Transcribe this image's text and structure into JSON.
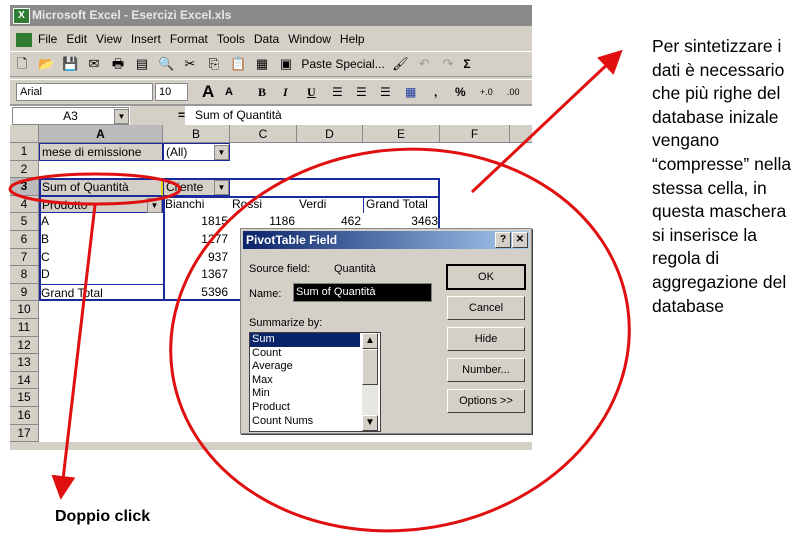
{
  "window": {
    "title": "Microsoft Excel - Esercizi Excel.xls"
  },
  "menu": [
    "File",
    "Edit",
    "View",
    "Insert",
    "Format",
    "Tools",
    "Data",
    "Window",
    "Help"
  ],
  "toolbar": {
    "paste_special": "Paste Special...",
    "sum_icon": "Σ"
  },
  "format_toolbar": {
    "font": "Arial",
    "size": "10",
    "bold": "B",
    "italic": "I",
    "underline": "U",
    "comma": ",",
    "percent": "%"
  },
  "formula_bar": {
    "name_box": "A3",
    "equals": "=",
    "content": "Sum of Quantità"
  },
  "columns": [
    "A",
    "B",
    "C",
    "D",
    "E",
    "F"
  ],
  "rows": [
    "1",
    "2",
    "3",
    "4",
    "5",
    "6",
    "7",
    "8",
    "9",
    "10",
    "11",
    "12",
    "13",
    "14",
    "15",
    "16",
    "17"
  ],
  "pivot": {
    "page_field": "mese di emissione",
    "page_value": "(All)",
    "data_field": "Sum of Quantità",
    "column_field": "Cliente",
    "row_field": "Prodotto",
    "column_items": [
      "Bianchi",
      "Rossi",
      "Verdi",
      "Grand Total"
    ],
    "row_items": [
      "A",
      "B",
      "C",
      "D",
      "Grand Total"
    ],
    "values": [
      [
        "1815",
        "1186",
        "462",
        "3463"
      ],
      [
        "1277"
      ],
      [
        "937"
      ],
      [
        "1367"
      ],
      [
        "5396"
      ]
    ]
  },
  "dialog": {
    "title": "PivotTable Field",
    "help": "?",
    "close": "✕",
    "source_label": "Source field:",
    "source_value": "Quantità",
    "name_label": "Name:",
    "name_value": "Sum of Quantità",
    "summarize_label": "Summarize by:",
    "functions": [
      "Sum",
      "Count",
      "Average",
      "Max",
      "Min",
      "Product",
      "Count Nums"
    ],
    "selected": "Sum",
    "buttons": [
      "OK",
      "Cancel",
      "Hide",
      "Number...",
      "Options >>"
    ]
  },
  "annotations": {
    "side_text": "Per sintetizzare i dati è necessario che più righe del database inizale vengano “compresse” nella stessa cella, in questa maschera si inserisce la regola di aggregazione del database",
    "click_label": "Doppio click",
    "color": "#e01010"
  }
}
